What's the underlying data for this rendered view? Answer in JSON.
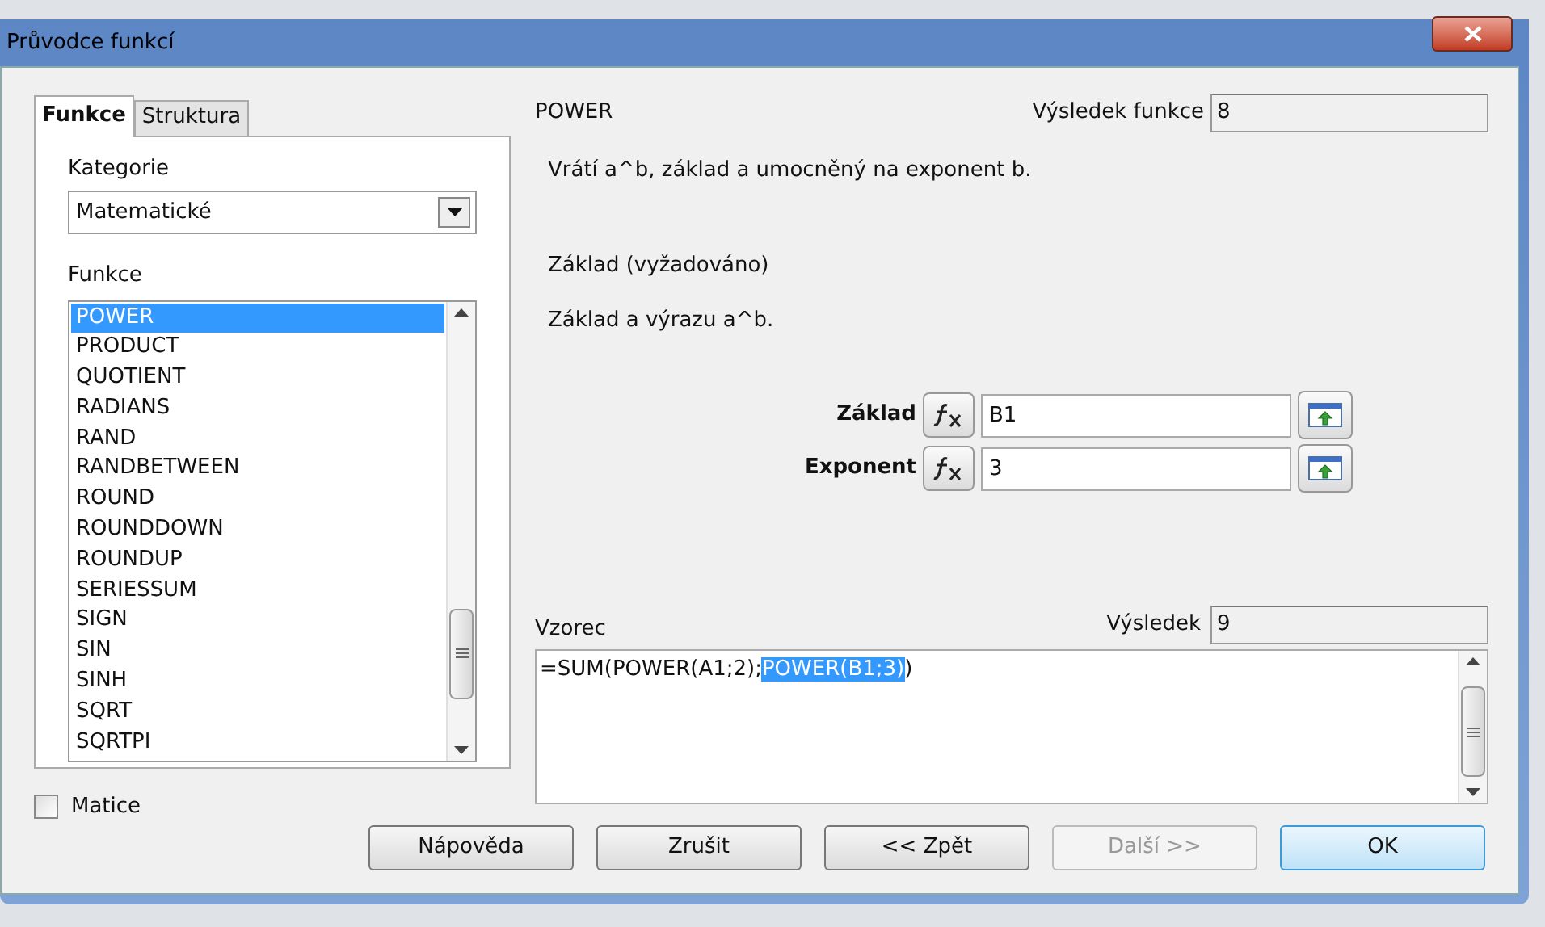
{
  "window": {
    "title": "Průvodce funkcí"
  },
  "tabs": [
    {
      "label": "Funkce",
      "selected": true
    },
    {
      "label": "Struktura",
      "selected": false
    }
  ],
  "category": {
    "label": "Kategorie",
    "value": "Matematické"
  },
  "functions": {
    "label": "Funkce",
    "items": [
      {
        "label": "POWER",
        "selected": true
      },
      {
        "label": "PRODUCT",
        "selected": false
      },
      {
        "label": "QUOTIENT",
        "selected": false
      },
      {
        "label": "RADIANS",
        "selected": false
      },
      {
        "label": "RAND",
        "selected": false
      },
      {
        "label": "RANDBETWEEN",
        "selected": false
      },
      {
        "label": "ROUND",
        "selected": false
      },
      {
        "label": "ROUNDDOWN",
        "selected": false
      },
      {
        "label": "ROUNDUP",
        "selected": false
      },
      {
        "label": "SERIESSUM",
        "selected": false
      },
      {
        "label": "SIGN",
        "selected": false
      },
      {
        "label": "SIN",
        "selected": false
      },
      {
        "label": "SINH",
        "selected": false
      },
      {
        "label": "SQRT",
        "selected": false
      },
      {
        "label": "SQRTPI",
        "selected": false
      }
    ]
  },
  "matrix": {
    "label": "Matice",
    "checked": false
  },
  "function_name": "POWER",
  "function_result": {
    "label": "Výsledek funkce",
    "value": "8"
  },
  "description": "Vrátí a^b, základ a umocněný na exponent b.",
  "argument_title": "Základ (vyžadováno)",
  "argument_description": "Základ a výrazu a^b.",
  "arguments": [
    {
      "label": "Základ",
      "value": "B1"
    },
    {
      "label": "Exponent",
      "value": "3"
    }
  ],
  "formula": {
    "label": "Vzorec",
    "parts": [
      {
        "text": "=SUM(POWER(A1;2);",
        "selected": false
      },
      {
        "text": "POWER(B1;3)",
        "selected": true
      },
      {
        "text": ")",
        "selected": false
      }
    ]
  },
  "result": {
    "label": "Výsledek",
    "value": "9"
  },
  "buttons": [
    {
      "label": "Nápověda",
      "disabled": false,
      "default": false
    },
    {
      "label": "Zrušit",
      "disabled": false,
      "default": false
    },
    {
      "label": "<< Zpět",
      "disabled": false,
      "default": false
    },
    {
      "label": "Další >>",
      "disabled": true,
      "default": false
    },
    {
      "label": "OK",
      "disabled": false,
      "default": true
    }
  ]
}
